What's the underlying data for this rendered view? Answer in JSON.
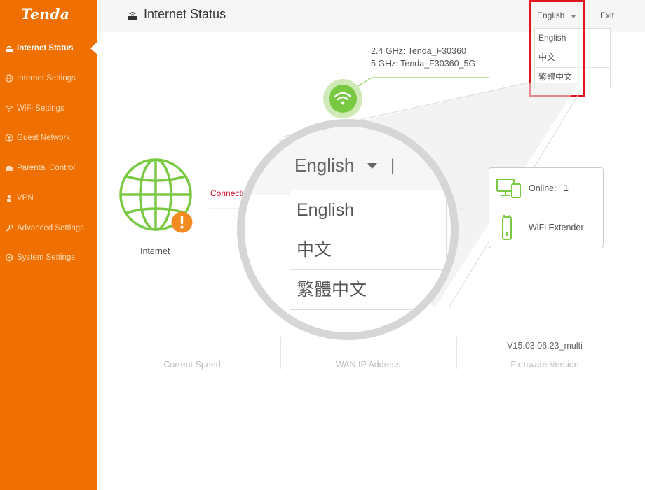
{
  "sidebar": {
    "logo": "Tenda",
    "items": [
      {
        "label": "Internet Status",
        "icon": "router-icon",
        "active": true
      },
      {
        "label": "Internet Settings",
        "icon": "globe-icon",
        "active": false
      },
      {
        "label": "WiFi Settings",
        "icon": "wifi-icon",
        "active": false
      },
      {
        "label": "Guest Network",
        "icon": "guest-icon",
        "active": false
      },
      {
        "label": "Parental Control",
        "icon": "parental-icon",
        "active": false
      },
      {
        "label": "VPN",
        "icon": "vpn-icon",
        "active": false
      },
      {
        "label": "Advanced Settings",
        "icon": "wrench-icon",
        "active": false
      },
      {
        "label": "System Settings",
        "icon": "gear-icon",
        "active": false
      }
    ]
  },
  "header": {
    "title": "Internet Status",
    "language": "English",
    "separator": "|",
    "exit": "Exit"
  },
  "language_dropdown": {
    "options": [
      "English",
      "中文",
      "繁體中文"
    ]
  },
  "wifi": {
    "ssid_24": "2.4 GHz: Tenda_F30360",
    "ssid_5": "5 GHz: Tenda_F30360_5G"
  },
  "internet": {
    "label": "Internet",
    "connection_link": "Connecti"
  },
  "devices": {
    "online_label": "Online:",
    "online_count": "1",
    "extender_label": "WiFi Extender"
  },
  "stats": {
    "current_speed_value": "--",
    "current_speed_label": "Current Speed",
    "wan_ip_value": "--",
    "wan_ip_label": "WAN IP Address",
    "firmware_value": "V15.03.06.23_multi",
    "firmware_label": "Firmware Version"
  },
  "magnifier": {
    "language": "English",
    "separator": "|",
    "options": [
      "English",
      "中文",
      "繁體中文"
    ]
  },
  "colors": {
    "brand_orange": "#ef7000",
    "green_accent": "#7ac943",
    "warning_orange": "#f18b1f",
    "highlight_red": "#e0151e"
  }
}
